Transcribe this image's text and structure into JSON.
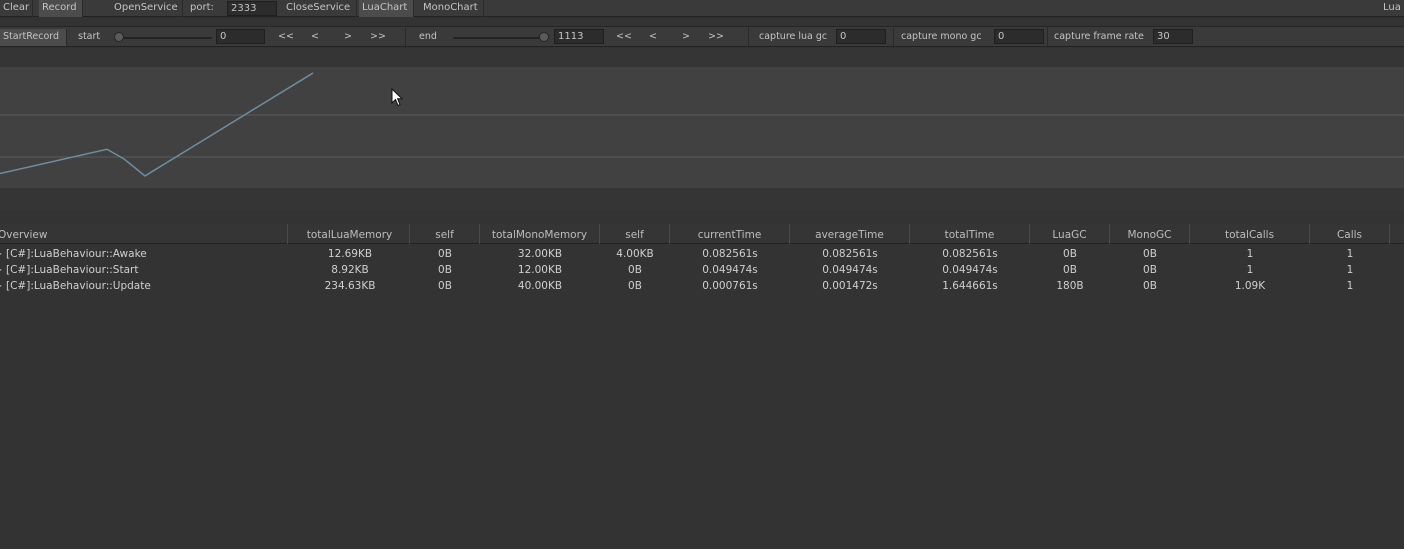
{
  "toolbar": {
    "clear": "Clear",
    "record": "Record",
    "open_service": "OpenService",
    "port_label": "port:",
    "port_value": "2333",
    "close_service": "CloseService",
    "lua_chart": "LuaChart",
    "mono_chart": "MonoChart",
    "right_label": "Lua"
  },
  "record_bar": {
    "start_record": "StartRecord",
    "start_label": "start",
    "start_value": "0",
    "start_slider_fraction": 0,
    "nav_first": "<<",
    "nav_prev": "<",
    "nav_next": ">",
    "nav_last": ">>",
    "end_label": "end",
    "end_value": "1113",
    "end_slider_fraction": 1,
    "capture_lua_gc_label": "capture lua gc",
    "capture_lua_gc_value": "0",
    "capture_mono_gc_label": "capture mono gc",
    "capture_mono_gc_value": "0",
    "capture_frame_rate_label": "capture frame rate",
    "capture_frame_rate_value": "30"
  },
  "chart_data": {
    "type": "line",
    "series": [
      {
        "values": [
          0.12,
          0.32,
          0.24,
          0.1,
          0.95
        ]
      }
    ],
    "x": [
      0,
      107,
      124,
      145,
      313
    ],
    "grid": true,
    "line_color": "#6f8ca0"
  },
  "table": {
    "columns": [
      "Overview",
      "totalLuaMemory",
      "self",
      "totalMonoMemory",
      "self",
      "currentTime",
      "averageTime",
      "totalTime",
      "LuaGC",
      "MonoGC",
      "totalCalls",
      "Calls"
    ],
    "rows": [
      [
        "[C#]:LuaBehaviour::Awake",
        "12.69KB",
        "0B",
        "32.00KB",
        "4.00KB",
        "0.082561s",
        "0.082561s",
        "0.082561s",
        "0B",
        "0B",
        "1",
        "1"
      ],
      [
        "[C#]:LuaBehaviour::Start",
        "8.92KB",
        "0B",
        "12.00KB",
        "0B",
        "0.049474s",
        "0.049474s",
        "0.049474s",
        "0B",
        "0B",
        "1",
        "1"
      ],
      [
        "[C#]:LuaBehaviour::Update",
        "234.63KB",
        "0B",
        "40.00KB",
        "0B",
        "0.000761s",
        "0.001472s",
        "1.644661s",
        "180B",
        "0B",
        "1.09K",
        "1"
      ]
    ]
  }
}
